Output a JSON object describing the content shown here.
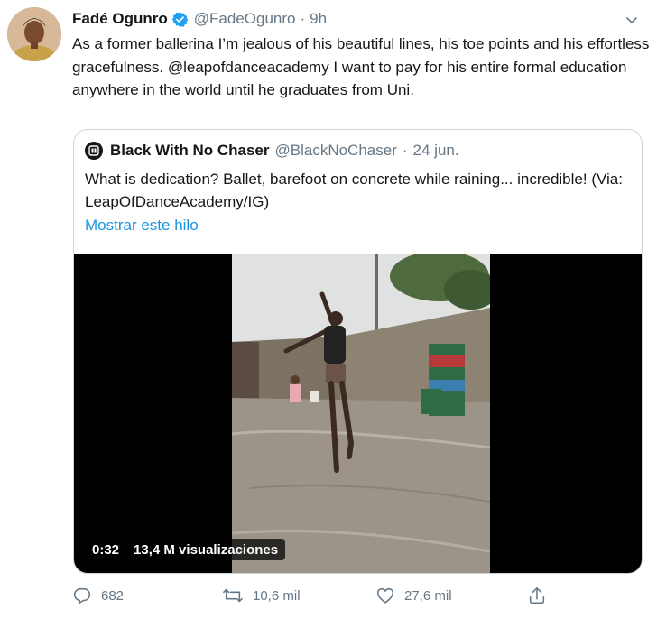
{
  "tweet": {
    "author_name": "Fadé Ogunro",
    "handle": "@FadeOgunro",
    "separator": "·",
    "time": "9h",
    "text": "As a former ballerina I’m jealous of his beautiful lines, his toe points and his effortless gracefulness. @leapofdanceacademy I want to pay for his entire formal education anywhere in the world until he graduates from Uni."
  },
  "quote": {
    "author_name": "Black With No Chaser",
    "handle": "@BlackNoChaser",
    "separator": "·",
    "date": "24 jun.",
    "text": "What is dedication? Ballet, barefoot on concrete while raining... incredible! (Via: LeapOfDanceAcademy/IG)",
    "show_thread_label": "Mostrar este hilo",
    "video": {
      "duration": "0:32",
      "views": "13,4 M visualizaciones"
    }
  },
  "actions": {
    "reply_count": "682",
    "retweet_count": "10,6 mil",
    "like_count": "27,6 mil"
  },
  "icons": {
    "verified": "verified-badge-icon",
    "caret": "chevron-down-icon",
    "reply": "reply-icon",
    "retweet": "retweet-icon",
    "like": "heart-icon",
    "share": "share-icon"
  },
  "colors": {
    "text": "#14171a",
    "secondary": "#657786",
    "link": "#1b95e0",
    "verified": "#1da1f2",
    "border": "#ccd6dd"
  }
}
